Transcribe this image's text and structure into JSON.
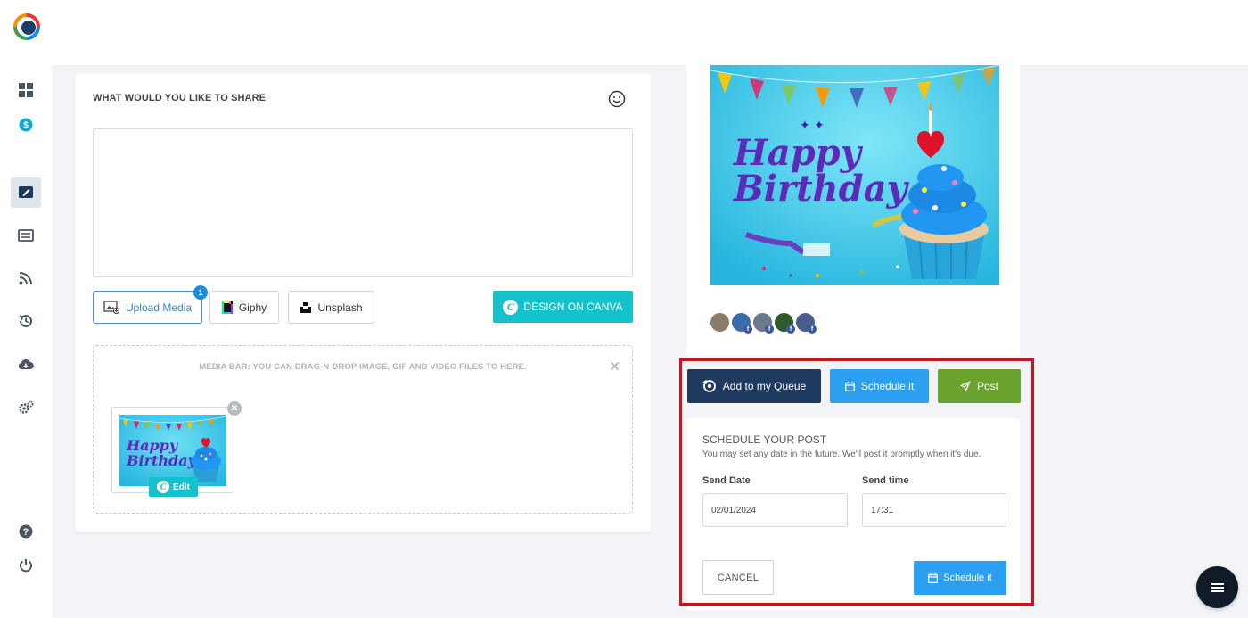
{
  "composer": {
    "title": "WHAT WOULD YOU LIKE TO SHARE",
    "text_value": "",
    "upload_label": "Upload Media",
    "upload_count": "1",
    "giphy_label": "Giphy",
    "unsplash_label": "Unsplash",
    "canva_label": "DESIGN ON CANVA",
    "media_bar_text": "MEDIA BAR: YOU CAN DRAG-N-DROP IMAGE, GIF AND VIDEO FILES TO HERE.",
    "edit_label": "Edit"
  },
  "preview": {
    "image_text_line1": "Happy",
    "image_text_line2": "Birthday",
    "avatars": [
      "f",
      "f",
      "f",
      "f",
      "f"
    ]
  },
  "actions": {
    "queue_label": "Add to my Queue",
    "schedule_label": "Schedule it",
    "post_label": "Post"
  },
  "schedule": {
    "title": "SCHEDULE YOUR POST",
    "subtitle": "You may set any date in the future. We'll post it promptly when it's due.",
    "date_label": "Send Date",
    "date_value": "02/01/2024",
    "time_label": "Send time",
    "time_value": "17:31",
    "cancel_label": "CANCEL",
    "submit_label": "Schedule it"
  },
  "colors": {
    "accent_teal": "#14c2cc",
    "queue_navy": "#1e3a5f",
    "schedule_blue": "#2d9ff0",
    "post_green": "#6aa32d",
    "highlight_red": "#c0181e"
  },
  "icons": {
    "sidebar": [
      "dashboard-icon",
      "billing-icon",
      "compose-icon",
      "list-icon",
      "rss-icon",
      "history-icon",
      "cloud-download-icon",
      "settings-icon",
      "help-icon",
      "power-icon"
    ]
  }
}
